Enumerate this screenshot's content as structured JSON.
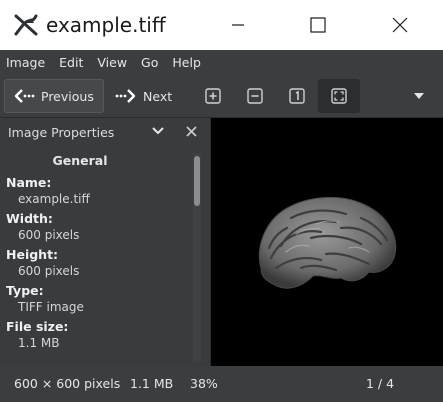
{
  "window": {
    "title": "example.tiff"
  },
  "menubar": {
    "items": [
      "Image",
      "Edit",
      "View",
      "Go",
      "Help"
    ]
  },
  "toolbar": {
    "previous_label": "Previous",
    "next_label": "Next"
  },
  "sidebar": {
    "title": "Image Properties",
    "section": "General",
    "properties": [
      {
        "label": "Name:",
        "value": "example.tiff"
      },
      {
        "label": "Width:",
        "value": "600 pixels"
      },
      {
        "label": "Height:",
        "value": "600 pixels"
      },
      {
        "label": "Type:",
        "value": "TIFF image"
      },
      {
        "label": "File size:",
        "value": "1.1 MB"
      }
    ]
  },
  "statusbar": {
    "dimensions": "600 × 600 pixels",
    "file_size": "1.1 MB",
    "zoom": "38%",
    "page": "1 / 4"
  },
  "colors": {
    "panel_bg": "#3b3e40",
    "canvas_bg": "#000000",
    "text": "#e6e6e6"
  },
  "icons": {
    "app": "eog-icon",
    "minimize": "minimize-icon",
    "maximize": "maximize-icon",
    "close": "close-icon"
  }
}
